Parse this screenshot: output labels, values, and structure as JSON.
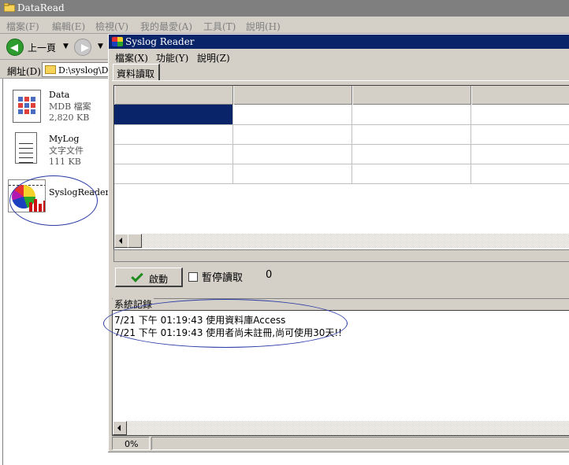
{
  "explorer": {
    "title": "DataRead",
    "menu": [
      "檔案(F)",
      "編輯(E)",
      "檢視(V)",
      "我的最愛(A)",
      "工具(T)",
      "說明(H)"
    ],
    "back_label": "上一頁",
    "address_label": "網址(D)",
    "address_value": "D:\\syslog\\DataRead",
    "files": [
      {
        "name": "Data",
        "type": "MDB 檔案",
        "size": "2,820 KB",
        "icon": "database-file-icon"
      },
      {
        "name": "MyLog",
        "type": "文字文件",
        "size": "111 KB",
        "icon": "text-file-icon"
      },
      {
        "name": "SyslogReader",
        "icon": "app-chart-icon"
      }
    ]
  },
  "app": {
    "title": "Syslog Reader",
    "menu": [
      "檔案(X)",
      "功能(Y)",
      "說明(Z)"
    ],
    "tab": "資料讀取",
    "start_button": "啟動",
    "pause_label": "暫停讀取",
    "pause_checked": false,
    "count": "0",
    "log_title": "系統記錄",
    "log_lines": [
      "7/21 下午 01:19:43 使用資料庫Access",
      "7/21 下午 01:19:43 使用者尚未註冊,尚可使用30天!!"
    ],
    "status": "0%"
  },
  "colors": {
    "selection": "#0a246a",
    "annotation": "#2a3aa5",
    "window_face": "#d4d0c8"
  }
}
